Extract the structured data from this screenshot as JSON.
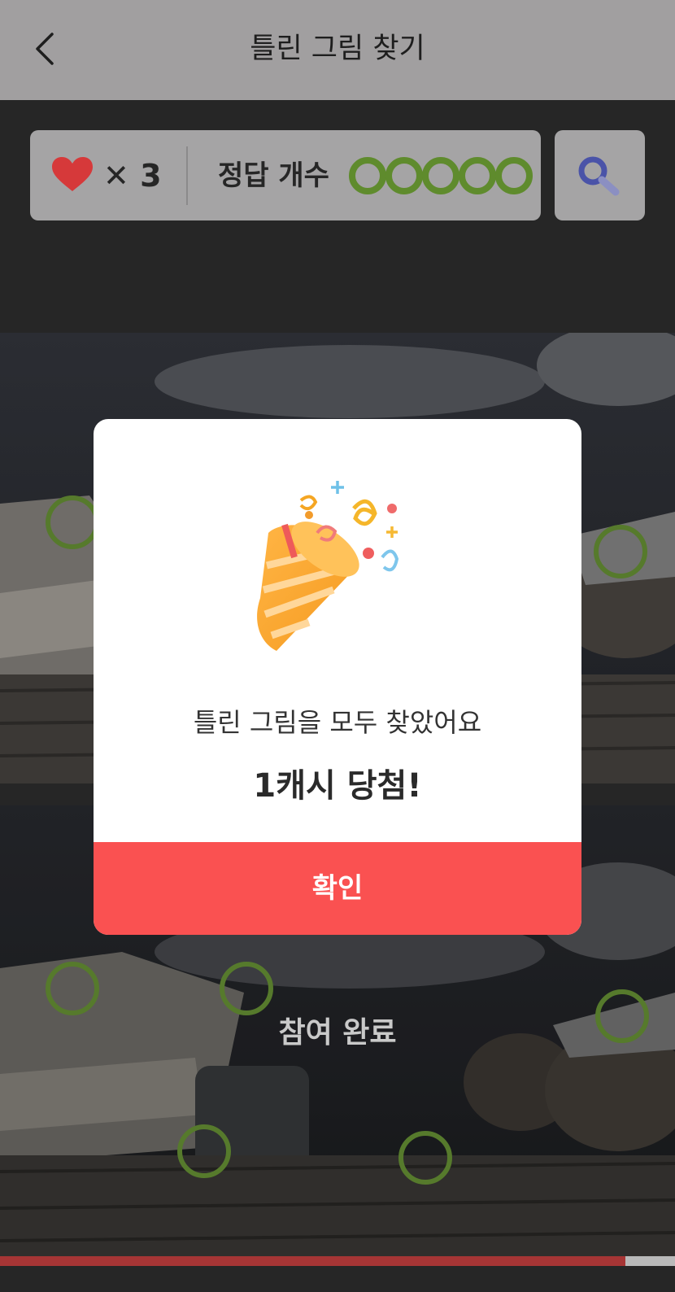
{
  "header": {
    "title": "틀린 그림 찾기",
    "back_icon": "chevron-left-icon"
  },
  "status": {
    "lives_label": "✕ 3",
    "answer_label": "정답 개수",
    "answers_found": 5,
    "answers_total": 5,
    "heart_color": "#d6393a",
    "found_color": "#5f8b2d"
  },
  "search_icon": "magnifier-icon",
  "game": {
    "completed_label": "참여 완료",
    "progress": 0.927
  },
  "modal": {
    "message": "틀린 그림을 모두 찾았어요",
    "prize": "1캐시 당첨!",
    "confirm_label": "확인",
    "confirm_color": "#fa5151"
  }
}
